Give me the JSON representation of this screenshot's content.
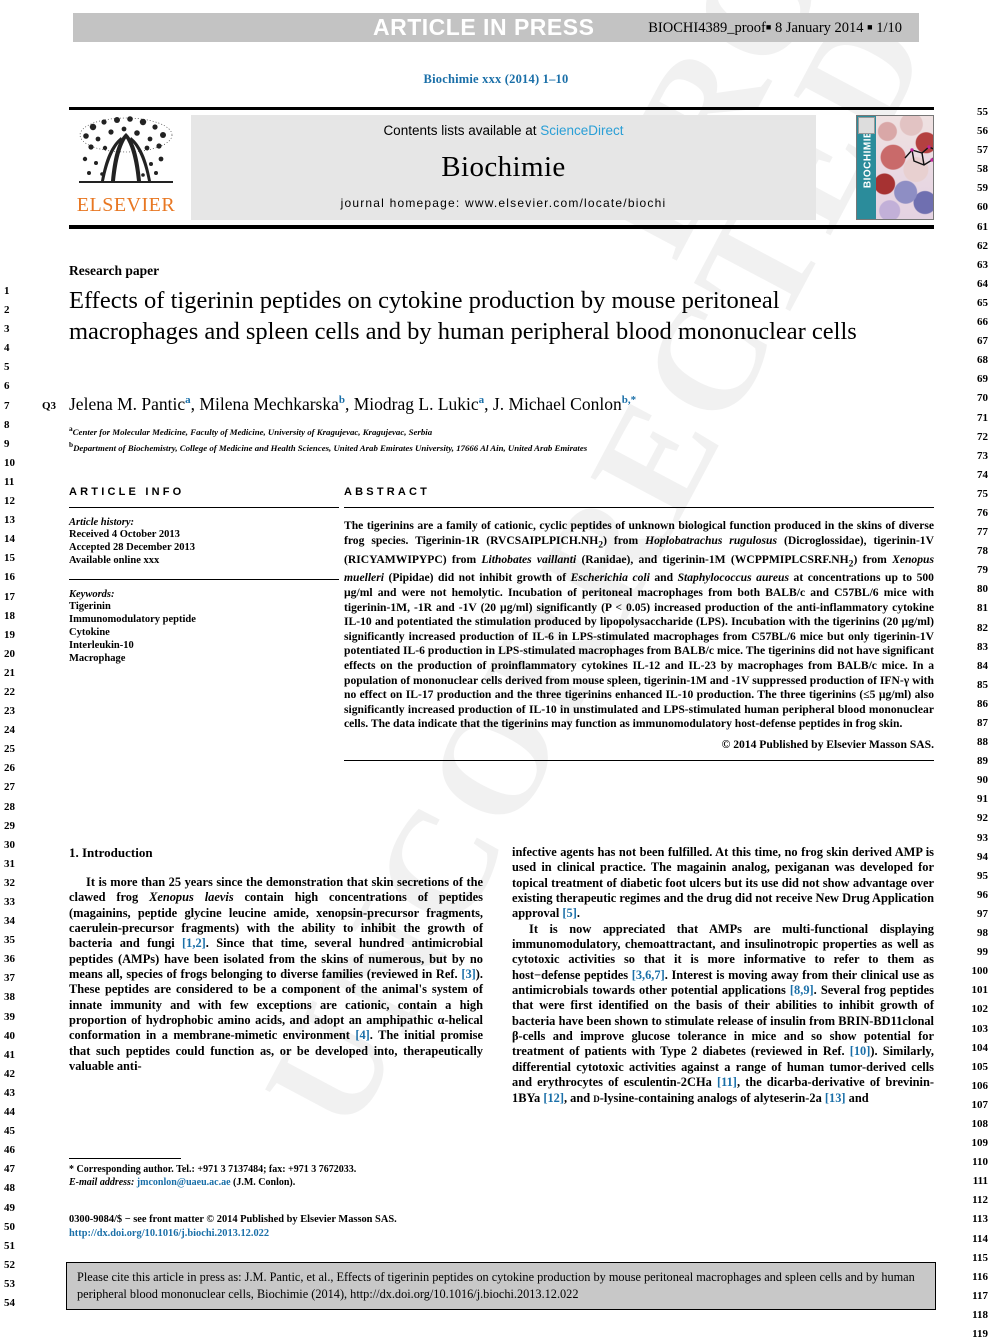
{
  "press_band": {
    "title": "ARTICLE IN PRESS",
    "meta_prefix": "BIOCHI4389_proof",
    "meta_date": "8 January 2014",
    "meta_page": "1/10"
  },
  "running_head": "Biochimie xxx (2014) 1–10",
  "masthead": {
    "contents_text": "Contents lists available at ",
    "contents_link": "ScienceDirect",
    "journal_name": "Biochimie",
    "homepage": "journal homepage: www.elsevier.com/locate/biochi",
    "publisher_logo_text": "ELSEVIER",
    "cover_spine_text": "BIOCHIMIE"
  },
  "article": {
    "section_type": "Research paper",
    "query_mark": "Q3",
    "title": "Effects of tigerinin peptides on cytokine production by mouse peritoneal macrophages and spleen cells and by human peripheral blood mononuclear cells",
    "authors": [
      {
        "name": "Jelena M. Pantic",
        "sup": "a",
        "sep": ", "
      },
      {
        "name": "Milena Mechkarska",
        "sup": "b",
        "sep": ", "
      },
      {
        "name": "Miodrag L. Lukic",
        "sup": "a",
        "sep": ", "
      },
      {
        "name": "J. Michael Conlon",
        "sup": "b,*",
        "sep": ""
      }
    ],
    "affiliations": [
      {
        "mark": "a",
        "text": "Center for Molecular Medicine, Faculty of Medicine, University of Kragujevac, Kragujevac, Serbia"
      },
      {
        "mark": "b",
        "text": "Department of Biochemistry, College of Medicine and Health Sciences, United Arab Emirates University, 17666 Al Ain, United Arab Emirates"
      }
    ]
  },
  "article_info": {
    "heading": "ARTICLE INFO",
    "history_label": "Article history:",
    "history": [
      "Received 4 October 2013",
      "Accepted 28 December 2013",
      "Available online xxx"
    ],
    "keywords_label": "Keywords:",
    "keywords": [
      "Tigerinin",
      "Immunomodulatory peptide",
      "Cytokine",
      "Interleukin-10",
      "Macrophage"
    ]
  },
  "abstract": {
    "heading": "ABSTRACT",
    "paragraph_html": "The tigerinins are a family of cationic, cyclic peptides of unknown biological function produced in the skins of diverse frog species. Tigerinin-1R (RVCSAIPLPICH.NH<sub>2</sub>) from <i>Hoplobatrachus rugulosus</i> (Dicroglossidae), tigerinin-1V (RICYAMWIPYPC) from <i>Lithobates vaillanti</i> (Ranidae), and tigerinin-1M (WCPPMIPLCSRF.NH<sub>2</sub>) from <i>Xenopus muelleri</i> (Pipidae) did not inhibit growth of <i>Escherichia coli</i> and <i>Staphylococcus aureus</i> at concentrations up to 500 µg/ml and were not hemolytic. Incubation of peritoneal macrophages from both BALB/c and C57BL/6 mice with tigerinin-1M, -1R and -1V (20 µg/ml) significantly (P &lt; 0.05) increased production of the anti-inflammatory cytokine IL-10 and potentiated the stimulation produced by lipopolysaccharide (LPS). Incubation with the tigerinins (20 µg/ml) significantly increased production of IL-6 in LPS-stimulated macrophages from C57BL/6 mice but only tigerinin-1V potentiated IL-6 production in LPS-stimulated macrophages from BALB/c mice. The tigerinins did not have significant effects on the production of proinflammatory cytokines IL-12 and IL-23 by macrophages from BALB/c mice. In a population of mononuclear cells derived from mouse spleen, tigerinin-1M and -1V suppressed production of IFN-γ with no effect on IL-17 production and the three tigerinins enhanced IL-10 production. The three tigerinins (≤5 µg/ml) also significantly increased production of IL-10 in unstimulated and LPS-stimulated human peripheral blood mononuclear cells. The data indicate that the tigerinins may function as immunomodulatory host-defense peptides in frog skin.",
    "copyright": "© 2014 Published by Elsevier Masson SAS."
  },
  "introduction": {
    "heading": "1. Introduction",
    "left_paragraphs_html": [
      "It is more than 25 years since the demonstration that skin secretions of the clawed frog <i>Xenopus laevis</i> contain high concentrations of peptides (magainins, peptide glycine leucine amide, xenopsin-precursor fragments, caerulein-precursor fragments) with the ability to inhibit the growth of bacteria and fungi <span class=\"ref\">[1,2]</span>. Since that time, several hundred antimicrobial peptides (AMPs) have been isolated from the skins of numerous, but by no means all, species of frogs belonging to diverse families (reviewed in Ref. <span class=\"ref\">[3]</span>). These peptides are considered to be a component of the animal's system of innate immunity and with few exceptions are cationic, contain a high proportion of hydrophobic amino acids, and adopt an amphipathic α-helical conformation in a membrane-mimetic environment <span class=\"ref\">[4]</span>. The initial promise that such peptides could function as, or be developed into, therapeutically valuable anti-"
    ],
    "right_paragraphs_html": [
      "infective agents has not been fulfilled. At this time, no frog skin derived AMP is used in clinical practice. The magainin analog, pexiganan was developed for topical treatment of diabetic foot ulcers but its use did not show advantage over existing therapeutic regimes and the drug did not receive New Drug Application approval <span class=\"ref\">[5]</span>.",
      "It is now appreciated that AMPs are multi-functional displaying immunomodulatory, chemoattractant, and insulinotropic properties as well as cytotoxic activities so that it is more informative to refer to them as host−defense peptides <span class=\"ref\">[3,6,7]</span>. Interest is moving away from their clinical use as antimicrobials towards other potential applications <span class=\"ref\">[8,9]</span>. Several frog peptides that were first identified on the basis of their abilities to inhibit growth of bacteria have been shown to stimulate release of insulin from BRIN-BD11clonal β-cells and improve glucose tolerance in mice and so show potential for treatment of patients with Type 2 diabetes (reviewed in Ref. <span class=\"ref\">[10]</span>). Similarly, differential cytotoxic activities against a range of human tumor-derived cells and erythrocytes of esculentin-2CHa <span class=\"ref\">[11]</span>, the dicarba-derivative of brevinin-1BYa <span class=\"ref\">[12]</span>, and <span style=\"font-variant:small-caps\">d</span>-lysine-containing analogs of alyteserin-2a <span class=\"ref\">[13]</span> and"
    ]
  },
  "footnote": {
    "corresponding_html": "* Corresponding author. Tel.: +971 3 7137484; fax: +971 3 7672033.",
    "email_label": "E-mail address:",
    "email": "jmconlon@uaeu.ac.ae",
    "email_suffix": "(J.M. Conlon)."
  },
  "front_matter": {
    "line1": "0300-9084/$ − see front matter © 2014 Published by Elsevier Masson SAS.",
    "doi": "http://dx.doi.org/10.1016/j.biochi.2013.12.022"
  },
  "citation_box": {
    "text": "Please cite this article in press as: J.M. Pantic, et al., Effects of tigerinin peptides on cytokine production by mouse peritoneal macrophages and spleen cells and by human peripheral blood mononuclear cells, Biochimie (2014), http://dx.doi.org/10.1016/j.biochi.2013.12.022"
  },
  "line_numbers": {
    "left_start": 1,
    "left_end": 54,
    "right_start": 55,
    "right_end": 119
  },
  "watermark": {
    "text_1": "PROOF",
    "text_2": "UNCORRECTED"
  },
  "colors": {
    "link": "#1a6fa8",
    "band": "#c3c3c3",
    "masthead_bg": "#e6e6e6",
    "elsevier_orange": "#E87722",
    "cover_teal": "#2b8c9b"
  }
}
